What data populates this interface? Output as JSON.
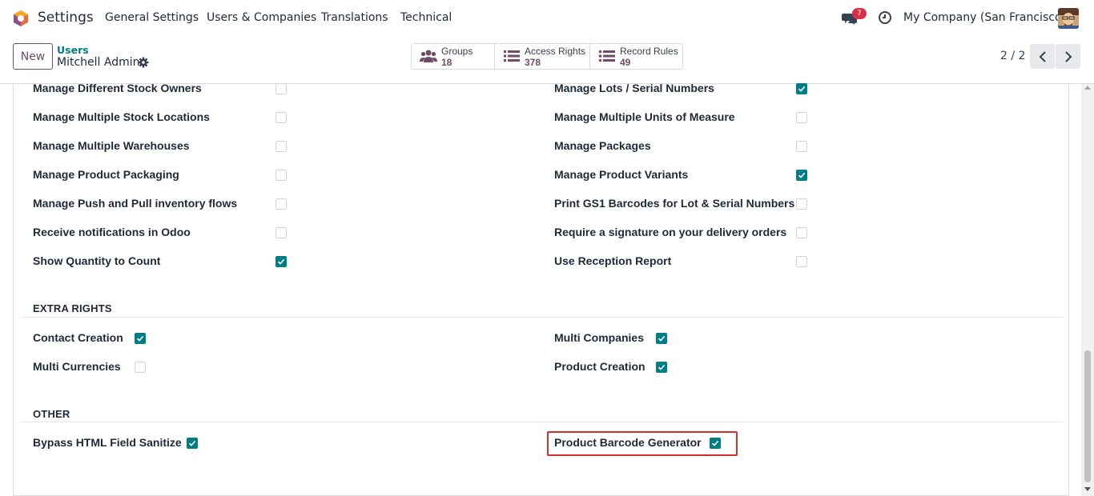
{
  "navbar": {
    "app_title": "Settings",
    "menu": [
      "General Settings",
      "Users & Companies",
      "Translations",
      "Technical"
    ],
    "notifications_count": "7",
    "company": "My Company (San Francisco)"
  },
  "control": {
    "new_label": "New",
    "breadcrumb_parent": "Users",
    "breadcrumb_current": "Mitchell Admin",
    "smart_buttons": [
      {
        "label": "Groups",
        "value": "18",
        "icon": "users-icon"
      },
      {
        "label": "Access Rights",
        "value": "378",
        "icon": "list-icon"
      },
      {
        "label": "Record Rules",
        "value": "49",
        "icon": "list-icon"
      }
    ],
    "pager": "2 / 2"
  },
  "inventory_left": [
    {
      "label": "Manage Different Stock Owners",
      "checked": false
    },
    {
      "label": "Manage Multiple Stock Locations",
      "checked": false
    },
    {
      "label": "Manage Multiple Warehouses",
      "checked": false
    },
    {
      "label": "Manage Product Packaging",
      "checked": false
    },
    {
      "label": "Manage Push and Pull inventory flows",
      "checked": false
    },
    {
      "label": "Receive notifications in Odoo",
      "checked": false
    },
    {
      "label": "Show Quantity to Count",
      "checked": true
    }
  ],
  "inventory_right": [
    {
      "label": "Manage Lots / Serial Numbers",
      "checked": true
    },
    {
      "label": "Manage Multiple Units of Measure",
      "checked": false
    },
    {
      "label": "Manage Packages",
      "checked": false
    },
    {
      "label": "Manage Product Variants",
      "checked": true
    },
    {
      "label": "Print GS1 Barcodes for Lot & Serial Numbers",
      "checked": false
    },
    {
      "label": "Require a signature on your delivery orders",
      "checked": false
    },
    {
      "label": "Use Reception Report",
      "checked": false
    }
  ],
  "extra_rights": {
    "title": "EXTRA RIGHTS",
    "left": [
      {
        "label": "Contact Creation",
        "checked": true
      },
      {
        "label": "Multi Currencies",
        "checked": false
      }
    ],
    "right": [
      {
        "label": "Multi Companies",
        "checked": true
      },
      {
        "label": "Product Creation",
        "checked": true
      }
    ]
  },
  "other": {
    "title": "OTHER",
    "left": [
      {
        "label": "Bypass HTML Field Sanitize",
        "checked": true
      }
    ],
    "right": [
      {
        "label": "Product Barcode Generator",
        "checked": true
      }
    ]
  },
  "colors": {
    "accent": "#017e84",
    "brand": "#714b67",
    "highlight": "#d62d2d",
    "badge": "#d9304a"
  }
}
